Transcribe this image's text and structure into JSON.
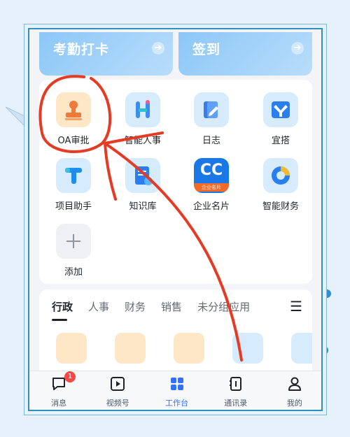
{
  "clock_cards": {
    "checkin_label": "考勤打卡",
    "sign_label": "签到"
  },
  "apps": [
    {
      "name": "OA审批",
      "icon": "oa-approval-icon"
    },
    {
      "name": "智能人事",
      "icon": "smart-hr-icon"
    },
    {
      "name": "日志",
      "icon": "log-icon"
    },
    {
      "name": "宜搭",
      "icon": "yida-icon"
    },
    {
      "name": "项目助手",
      "icon": "project-assistant-icon"
    },
    {
      "name": "知识库",
      "icon": "knowledge-base-icon"
    },
    {
      "name": "企业名片",
      "icon": "business-card-icon",
      "icon_text": "CC",
      "icon_sub": "企业名片"
    },
    {
      "name": "智能财务",
      "icon": "smart-finance-icon"
    },
    {
      "name": "添加",
      "icon": "add-icon"
    }
  ],
  "tabs": [
    {
      "label": "行政",
      "active": true
    },
    {
      "label": "人事",
      "active": false
    },
    {
      "label": "财务",
      "active": false
    },
    {
      "label": "销售",
      "active": false
    },
    {
      "label": "未分组应用",
      "active": false
    }
  ],
  "tabs_menu_glyph": "☰",
  "bottom_nav": [
    {
      "label": "消息",
      "icon": "message-icon",
      "badge": "1"
    },
    {
      "label": "视频号",
      "icon": "video-icon"
    },
    {
      "label": "工作台",
      "icon": "workbench-icon",
      "active": true
    },
    {
      "label": "通讯录",
      "icon": "contacts-icon"
    },
    {
      "label": "我的",
      "icon": "profile-icon"
    }
  ],
  "colors": {
    "accent": "#3370ff",
    "annotation": "#e53b24",
    "badge": "#f54a45"
  }
}
